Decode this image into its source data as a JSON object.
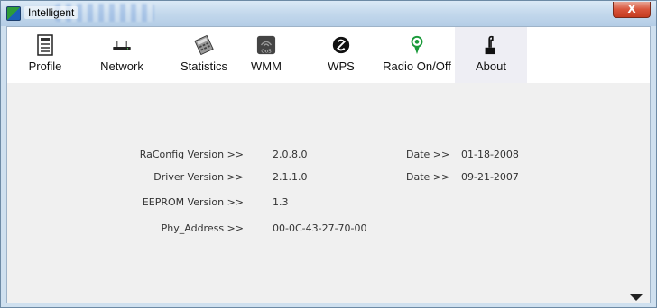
{
  "window": {
    "title": "Intelligent",
    "close_label": "X"
  },
  "toolbar": {
    "items": [
      {
        "label": "Profile",
        "icon": "profile-icon"
      },
      {
        "label": "Network",
        "icon": "network-icon"
      },
      {
        "label": "Statistics",
        "icon": "statistics-icon"
      },
      {
        "label": "WMM",
        "icon": "wmm-icon",
        "icon_text": "QoS"
      },
      {
        "label": "WPS",
        "icon": "wps-icon"
      },
      {
        "label": "Radio On/Off",
        "icon": "radio-icon"
      },
      {
        "label": "About",
        "icon": "about-icon",
        "active": true
      }
    ]
  },
  "about": {
    "raconfig_label": "RaConfig Version >>",
    "raconfig_value": "2.0.8.0",
    "raconfig_date_label": "Date >>",
    "raconfig_date_value": "01-18-2008",
    "driver_label": "Driver Version >>",
    "driver_value": "2.1.1.0",
    "driver_date_label": "Date >>",
    "driver_date_value": "09-21-2007",
    "eeprom_label": "EEPROM Version >>",
    "eeprom_value": "1.3",
    "phy_label": "Phy_Address >>",
    "phy_value": "00-0C-43-27-70-00"
  }
}
